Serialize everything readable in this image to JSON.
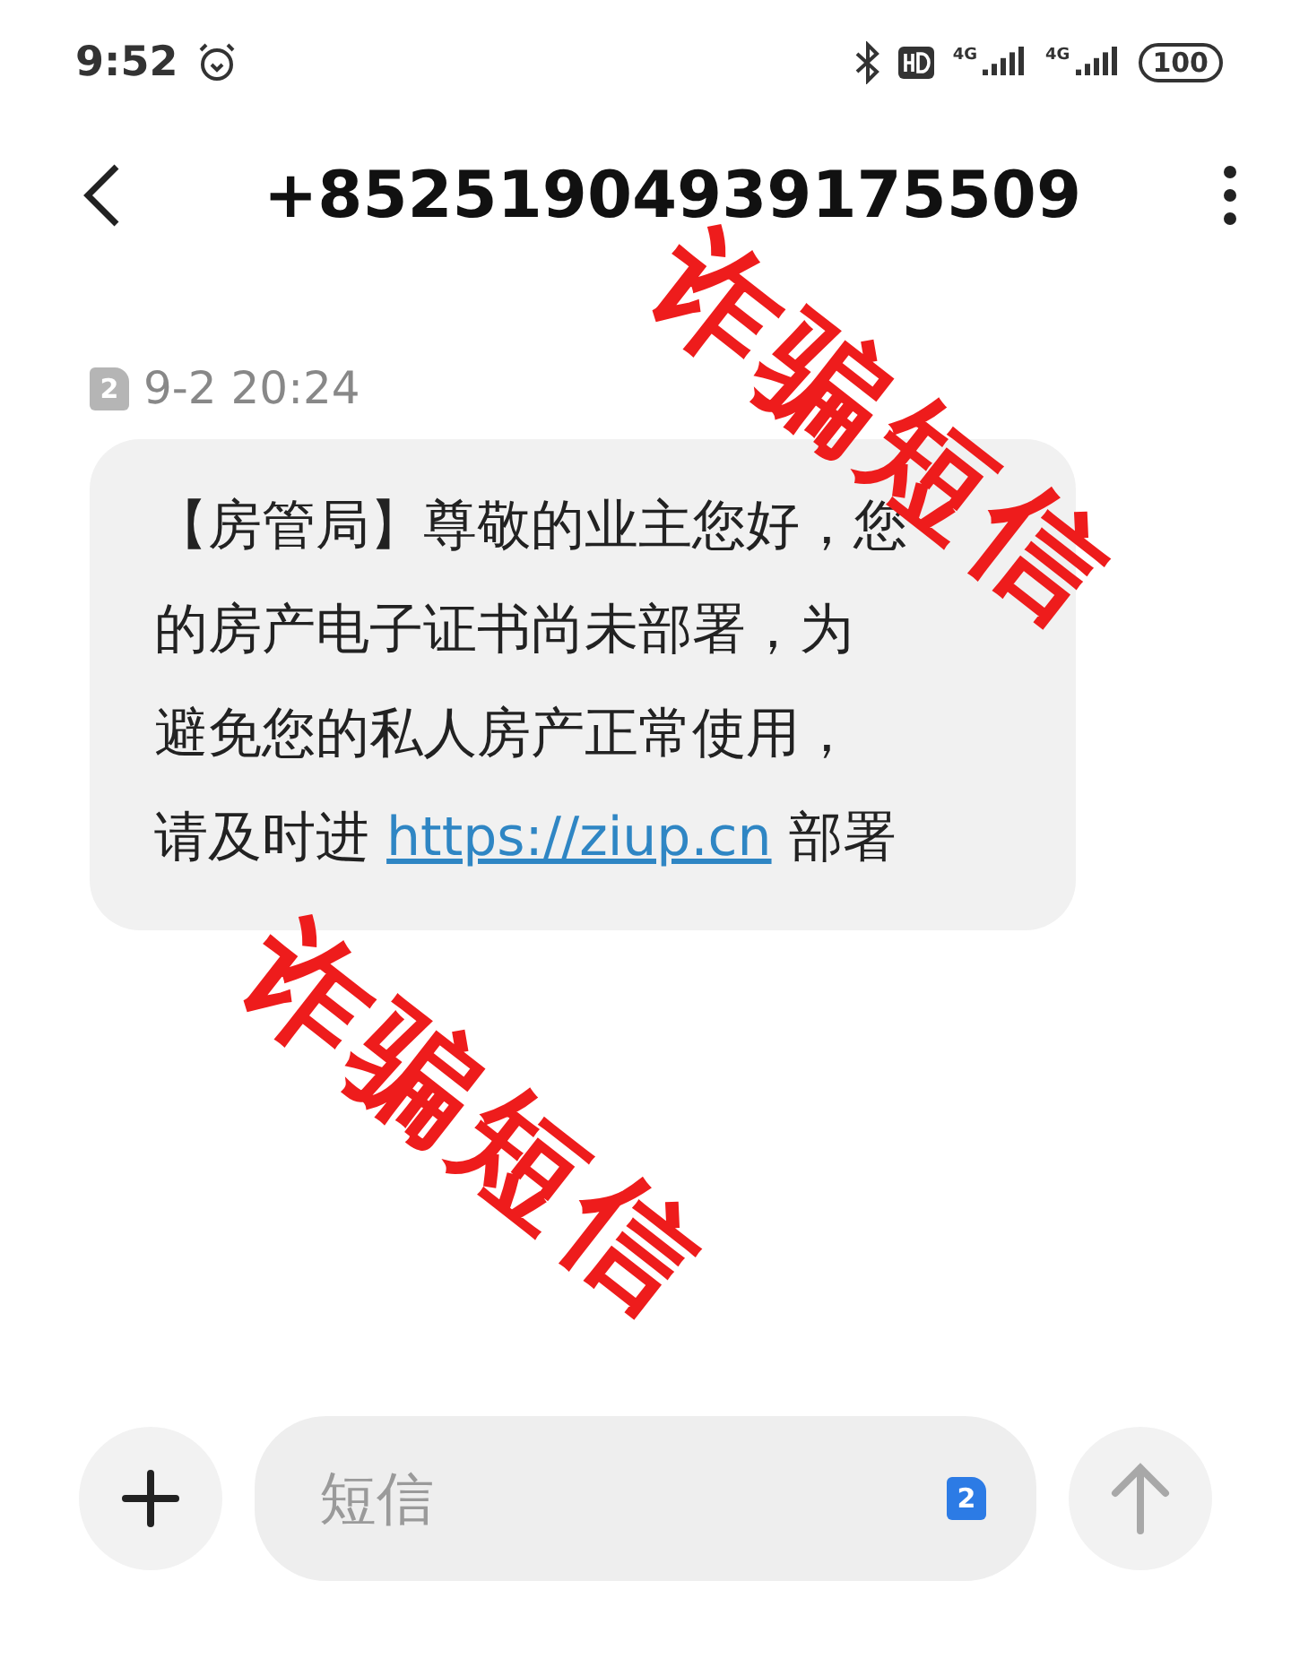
{
  "status_bar": {
    "time": "9:52",
    "network_1": "4G",
    "network_2": "4G",
    "battery": "100"
  },
  "header": {
    "title": "+85251904939175509"
  },
  "message": {
    "sim": "2",
    "timestamp": "9-2 20:24",
    "lines": [
      "【房管局】尊敬的业主您好，您",
      "的房产电子证书尚未部署，为",
      "避免您的私人房产正常使用，"
    ],
    "last_line": {
      "before": "请及时进 ",
      "link": "https://ziup.cn",
      "after": " 部署"
    }
  },
  "composer": {
    "placeholder": "短信",
    "sim": "2"
  },
  "annotations": [
    {
      "text": "诈骗短信",
      "color": "#ee1c1c"
    },
    {
      "text": "诈骗短信",
      "color": "#ee1c1c"
    }
  ]
}
